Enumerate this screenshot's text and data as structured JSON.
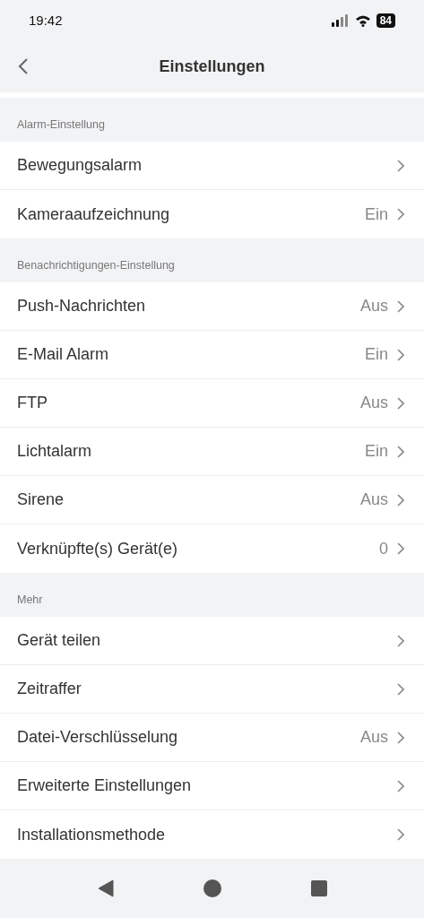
{
  "status_bar": {
    "time": "19:42",
    "battery": "84"
  },
  "header": {
    "title": "Einstellungen"
  },
  "sections": [
    {
      "title": "Alarm-Einstellung",
      "items": [
        {
          "label": "Bewegungsalarm"
        },
        {
          "label": "Kameraaufzeichnung",
          "value": "Ein"
        }
      ]
    },
    {
      "title": "Benachrichtigungen-Einstellung",
      "items": [
        {
          "label": "Push-Nachrichten",
          "value": "Aus"
        },
        {
          "label": "E-Mail Alarm",
          "value": "Ein"
        },
        {
          "label": "FTP",
          "value": "Aus"
        },
        {
          "label": "Lichtalarm",
          "value": "Ein"
        },
        {
          "label": "Sirene",
          "value": "Aus"
        },
        {
          "label": "Verknüpfte(s) Gerät(e)",
          "value": "0"
        }
      ]
    },
    {
      "title": "Mehr",
      "items": [
        {
          "label": "Gerät teilen"
        },
        {
          "label": "Zeitraffer"
        },
        {
          "label": "Datei-Verschlüsselung",
          "value": "Aus"
        },
        {
          "label": "Erweiterte Einstellungen"
        },
        {
          "label": "Installationsmethode"
        }
      ]
    }
  ]
}
